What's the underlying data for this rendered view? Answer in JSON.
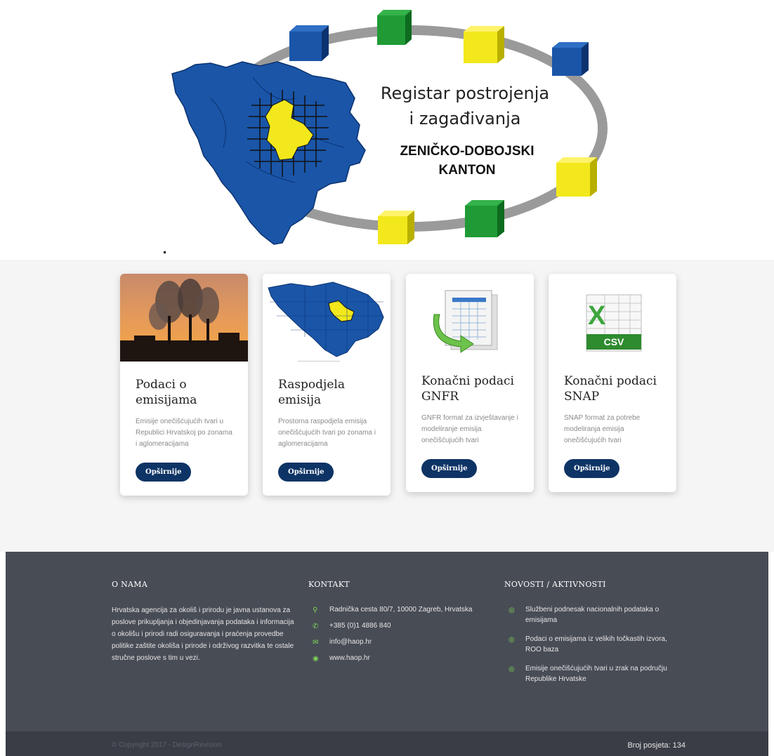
{
  "logo": {
    "line1": "Registar postrojenja",
    "line2": "i zagađivanja",
    "line3": "ZENIČKO-DOBOJSKI",
    "line4": "KANTON"
  },
  "cards": [
    {
      "title_line1": "Podaci o",
      "title_line2": "emisijama",
      "description": "Emisije onečišćujućih tvari u Republici Hrvatskoj po zonama i aglomeracijama",
      "button": "Opširnije"
    },
    {
      "title_line1": "Raspodjela",
      "title_line2": "emisija",
      "description": "Prostorna raspodjela emisija onečišćujućih tvari po zonama i aglomeracijama",
      "button": "Opširnije"
    },
    {
      "title_line1": "Konačni podaci",
      "title_line2": "GNFR",
      "description": "GNFR format za izvještavanje i modeliranje emisija onečišćujućih tvari",
      "button": "Opširnije"
    },
    {
      "title_line1": "Konačni podaci",
      "title_line2": "SNAP",
      "description": "SNAP format za potrebe modeliranja emisija onečišćujućih tvari",
      "button": "Opširnije"
    }
  ],
  "csv_label": "CSV",
  "footer": {
    "about": {
      "heading": "O NAMA",
      "text": "Hrvatska agencija za okoliš i prirodu je javna ustanova za poslove prikupljanja i objedinjavanja podataka i informacija o okolišu i prirodi radi osiguravanja i praćenja provedbe politike zaštite okoliša i prirode i održivog razvitka te ostale stručne poslove s tim u vezi."
    },
    "contact": {
      "heading": "KONTAKT",
      "address": "Radnička cesta 80/7, 10000 Zagreb, Hrvatska",
      "phone": "+385 (0)1 4886 840",
      "email": "info@haop.hr",
      "web": "www.haop.hr"
    },
    "news": {
      "heading": "NOVOSTI / AKTIVNOSTI",
      "items": [
        "Službeni podnesak nacionalnih podataka o emisijama",
        "Podaci o emisijama iz velikih točkastih izvora, ROO baza",
        "Emisije onečišćujućih tvari u zrak na području Republike Hrvatske"
      ]
    }
  },
  "bottom": {
    "copyright": "© Copyright 2017 - DesignRevision",
    "visits": "Broj posjeta: 134"
  },
  "colors": {
    "button": "#0e3466",
    "footer": "#484c55",
    "footer_bottom": "#3a3d45",
    "accent_green": "#7ed957",
    "map_blue": "#1a55a8",
    "map_yellow": "#f2e81c"
  },
  "icons": [
    "map-marker-icon",
    "phone-icon",
    "envelope-icon",
    "globe-icon",
    "circle-bullet-icon"
  ]
}
